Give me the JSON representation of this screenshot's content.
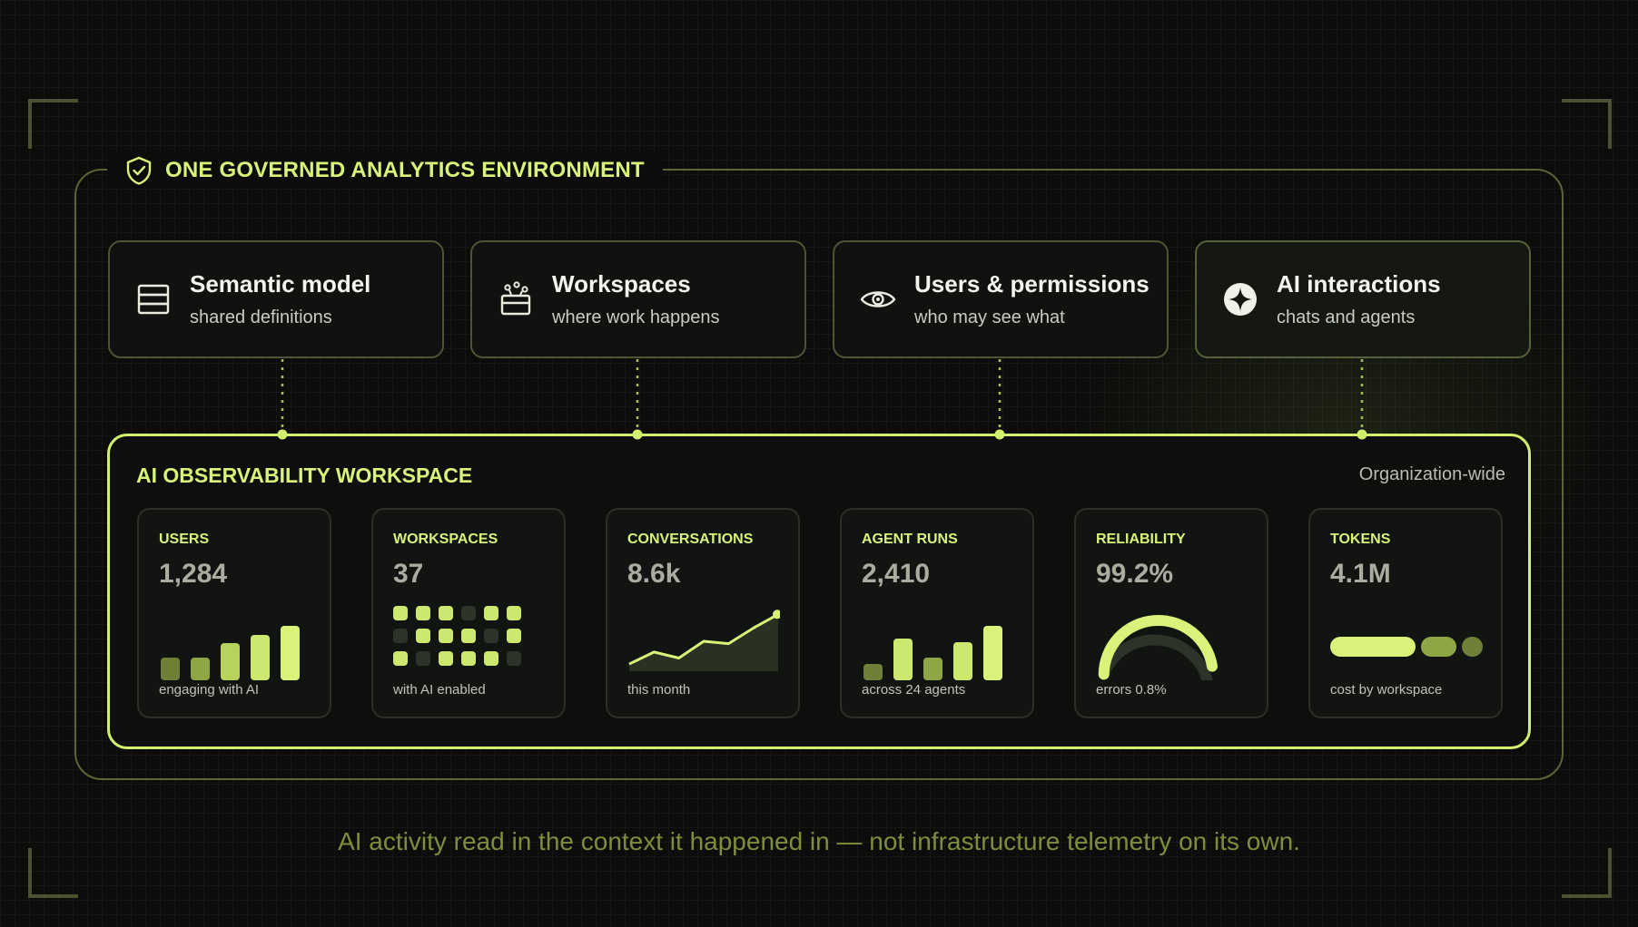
{
  "environment": {
    "title": "ONE GOVERNED ANALYTICS ENVIRONMENT",
    "icon": "shield-check-icon"
  },
  "top_cards": [
    {
      "title": "Semantic model",
      "subtitle": "shared definitions",
      "icon": "layers-stack-icon"
    },
    {
      "title": "Workspaces",
      "subtitle": "where work happens",
      "icon": "workspace-box-icon"
    },
    {
      "title": "Users & permissions",
      "subtitle": "who may see what",
      "icon": "eye-icon"
    },
    {
      "title": "AI interactions",
      "subtitle": "chats and agents",
      "icon": "sparkle-icon"
    }
  ],
  "workspace": {
    "title": "AI OBSERVABILITY WORKSPACE",
    "scope": "Organization-wide"
  },
  "metrics": [
    {
      "label": "USERS",
      "value": "1,284",
      "caption": "engaging with AI",
      "viz": "bars-ascending",
      "bar_levels": [
        0.42,
        0.42,
        0.68,
        0.83,
        1.0
      ]
    },
    {
      "label": "WORKSPACES",
      "value": "37",
      "caption": "with AI enabled",
      "viz": "dot-grid",
      "dot_states": [
        [
          1,
          1,
          1,
          0,
          1,
          1
        ],
        [
          0,
          1,
          1,
          1,
          0,
          1
        ],
        [
          1,
          0,
          1,
          1,
          1,
          0
        ]
      ]
    },
    {
      "label": "CONVERSATIONS",
      "value": "8.6k",
      "caption": "this month",
      "viz": "line-area",
      "line_series": [
        0.12,
        0.32,
        0.22,
        0.5,
        0.46,
        0.72,
        0.95
      ]
    },
    {
      "label": "AGENT RUNS",
      "value": "2,410",
      "caption": "across 24 agents",
      "viz": "bars-mixed",
      "bar_levels": [
        0.3,
        0.77,
        0.42,
        0.7,
        1.0
      ]
    },
    {
      "label": "RELIABILITY",
      "value": "99.2%",
      "caption": "errors 0.8%",
      "viz": "gauge",
      "gauge_level": 0.992
    },
    {
      "label": "TOKENS",
      "value": "4.1M",
      "caption": "cost by workspace",
      "viz": "segmented-bar",
      "segment_shares": [
        0.6,
        0.25,
        0.15
      ]
    }
  ],
  "colors": {
    "accent": "#d8f27a",
    "accent_bright": "#d2f06e",
    "muted_olive": "#7d8e3c",
    "bar_levels_palette": [
      "#6f8038",
      "#8fa646",
      "#b7d35c",
      "#cde86e",
      "#d8f27a"
    ],
    "dot_on": "#cde86e",
    "dot_off": "#2e3329"
  },
  "footer": {
    "text": "AI activity read in the context it happened in — not infrastructure telemetry on its own."
  }
}
